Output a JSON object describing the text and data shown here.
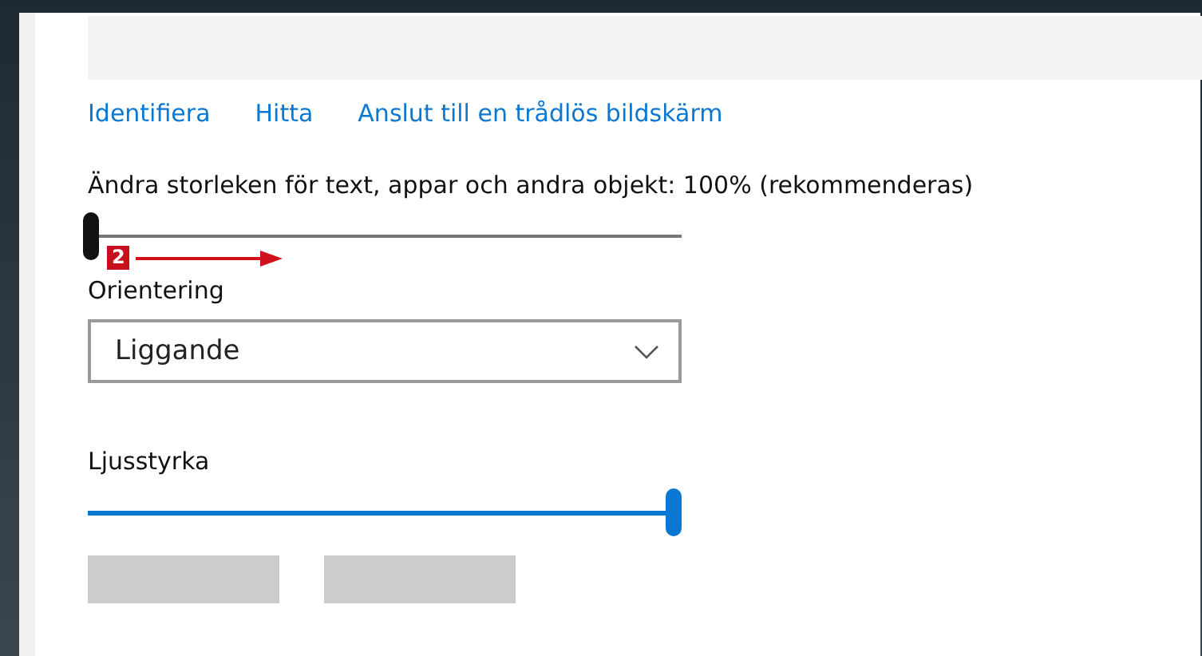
{
  "links": [
    {
      "label": "Identifiera"
    },
    {
      "label": "Hitta"
    },
    {
      "label": "Anslut till en trådlös bildskärm"
    }
  ],
  "scale": {
    "label": "Ändra storleken för text, appar och andra objekt: 100% (rekommenderas)",
    "level": 0
  },
  "annotation": {
    "badge": "2"
  },
  "orientation": {
    "label": "Orientering",
    "value": "Liggande"
  },
  "brightness": {
    "label": "Ljusstyrka",
    "level": 1
  }
}
